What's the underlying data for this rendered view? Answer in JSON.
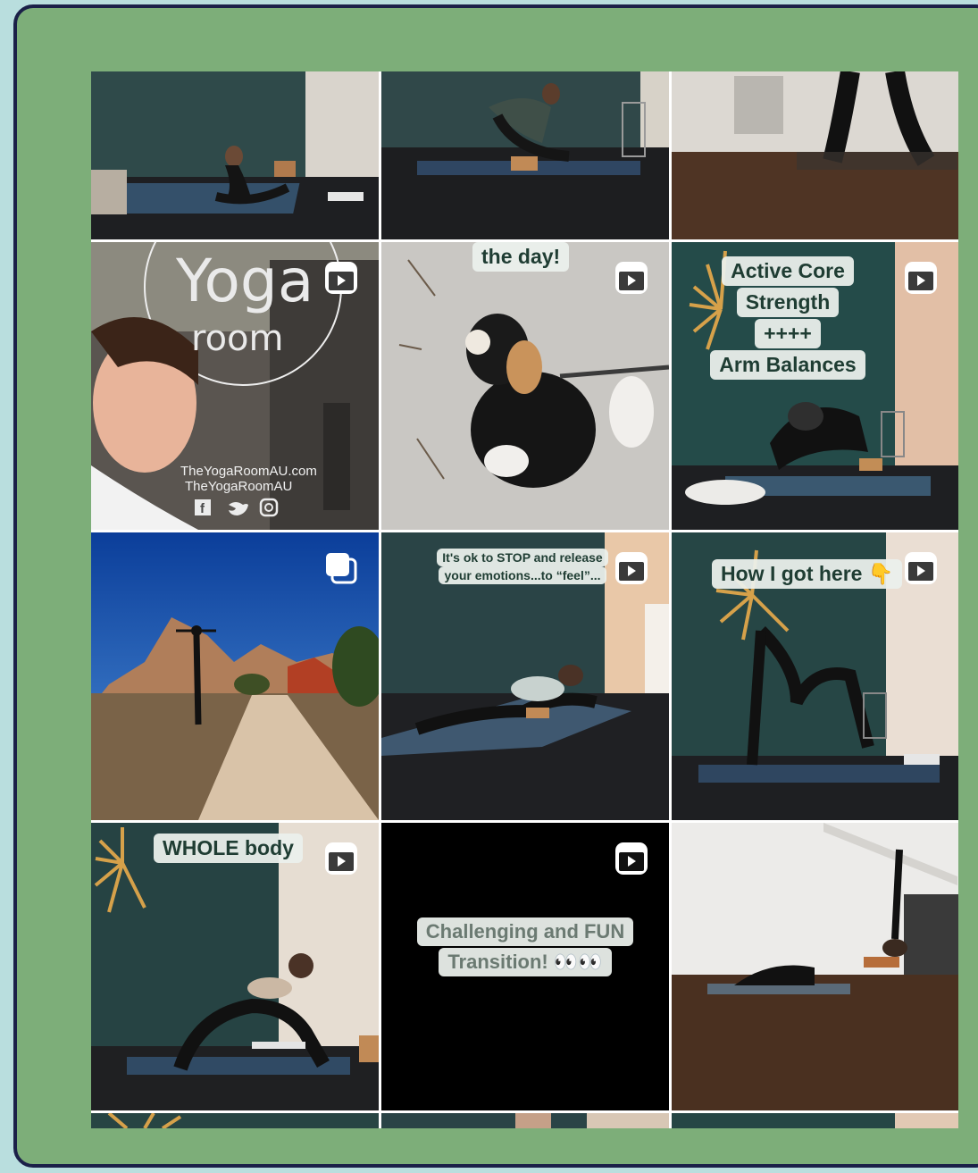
{
  "grid": {
    "tiles": [
      {
        "type": "photo",
        "caption": ""
      },
      {
        "type": "photo",
        "caption": ""
      },
      {
        "type": "photo",
        "caption": ""
      },
      {
        "type": "reel",
        "logo_word1": "Yoga",
        "logo_word2": "room",
        "links": [
          "TheYogaRoomAU.com",
          "TheYogaRoomAU"
        ]
      },
      {
        "type": "reel",
        "caption": "the day!"
      },
      {
        "type": "reel",
        "caption_lines": [
          "Active Core",
          "Strength",
          "++++",
          "Arm Balances"
        ]
      },
      {
        "type": "carousel",
        "caption": ""
      },
      {
        "type": "reel",
        "caption_lines": [
          "It's ok to STOP and release",
          "your emotions...to “feel”..."
        ]
      },
      {
        "type": "reel",
        "caption": "How I got here 👇"
      },
      {
        "type": "reel",
        "caption": "WHOLE body"
      },
      {
        "type": "reel",
        "caption_lines": [
          "Challenging and FUN",
          "Transition! 👀👀"
        ]
      },
      {
        "type": "photo",
        "caption": ""
      }
    ]
  },
  "icons": {
    "reel": "reels-icon",
    "carousel": "carousel-icon",
    "social": [
      "facebook-icon",
      "twitter-icon",
      "instagram-icon"
    ]
  },
  "colors": {
    "frame_bg": "#7dae79",
    "frame_border": "#1b2048",
    "page_bg": "#b9dede",
    "caption_text": "#1f3d33"
  }
}
